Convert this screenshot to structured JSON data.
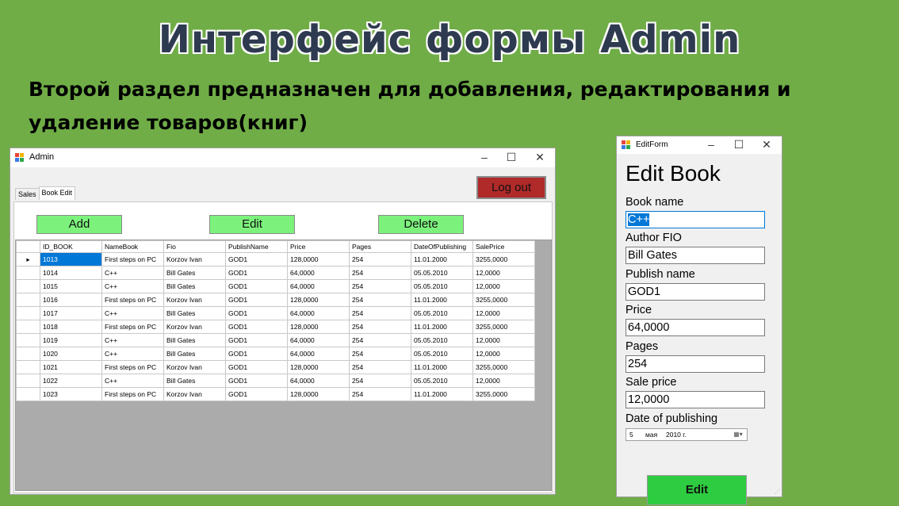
{
  "slide": {
    "title": "Интерфейс формы Admin",
    "subtitle": "Второй раздел предназначен для добавления, редактирования и удаление товаров(книг)"
  },
  "admin_window": {
    "title": "Admin",
    "controls": {
      "minimize": "–",
      "maximize": "☐",
      "close": "✕"
    },
    "tabs": [
      {
        "label": "Sales",
        "active": false
      },
      {
        "label": "Book Edit",
        "active": true
      }
    ],
    "logout_label": "Log out",
    "add_label": "Add",
    "edit_label": "Edit",
    "delete_label": "Delete",
    "colors": {
      "logout": "#b02a2a",
      "action_buttons": "#7cf27c",
      "selection": "#0078d7"
    },
    "grid": {
      "row_indicator": "▸",
      "columns": [
        "ID_BOOK",
        "NameBook",
        "Fio",
        "PublishName",
        "Price",
        "Pages",
        "DateOfPublishing",
        "SalePrice"
      ],
      "rows": [
        [
          "1013",
          "First steps on PC",
          "Korzov Ivan",
          "GOD1",
          "128,0000",
          "254",
          "11.01.2000",
          "3255,0000"
        ],
        [
          "1014",
          "C++",
          "Bill Gates",
          "GOD1",
          "64,0000",
          "254",
          "05.05.2010",
          "12,0000"
        ],
        [
          "1015",
          "C++",
          "Bill Gates",
          "GOD1",
          "64,0000",
          "254",
          "05.05.2010",
          "12,0000"
        ],
        [
          "1016",
          "First steps on PC",
          "Korzov Ivan",
          "GOD1",
          "128,0000",
          "254",
          "11.01.2000",
          "3255,0000"
        ],
        [
          "1017",
          "C++",
          "Bill Gates",
          "GOD1",
          "64,0000",
          "254",
          "05.05.2010",
          "12,0000"
        ],
        [
          "1018",
          "First steps on PC",
          "Korzov Ivan",
          "GOD1",
          "128,0000",
          "254",
          "11.01.2000",
          "3255,0000"
        ],
        [
          "1019",
          "C++",
          "Bill Gates",
          "GOD1",
          "64,0000",
          "254",
          "05.05.2010",
          "12,0000"
        ],
        [
          "1020",
          "C++",
          "Bill Gates",
          "GOD1",
          "64,0000",
          "254",
          "05.05.2010",
          "12,0000"
        ],
        [
          "1021",
          "First steps on PC",
          "Korzov Ivan",
          "GOD1",
          "128,0000",
          "254",
          "11.01.2000",
          "3255,0000"
        ],
        [
          "1022",
          "C++",
          "Bill Gates",
          "GOD1",
          "64,0000",
          "254",
          "05.05.2010",
          "12,0000"
        ],
        [
          "1023",
          "First steps on PC",
          "Korzov Ivan",
          "GOD1",
          "128,0000",
          "254",
          "11.01.2000",
          "3255,0000"
        ]
      ]
    }
  },
  "edit_window": {
    "title": "EditForm",
    "controls": {
      "minimize": "–",
      "maximize": "☐",
      "close": "✕"
    },
    "heading": "Edit Book",
    "fields": {
      "book_name": {
        "label": "Book name",
        "value": "C++"
      },
      "author": {
        "label": "Author FIO",
        "value": "Bill Gates"
      },
      "publish": {
        "label": "Publish name",
        "value": "GOD1"
      },
      "price": {
        "label": "Price",
        "value": "64,0000"
      },
      "pages": {
        "label": "Pages",
        "value": "254"
      },
      "sale_price": {
        "label": "Sale price",
        "value": "12,0000"
      }
    },
    "date": {
      "label": "Date of publishing",
      "day": "5",
      "month": "мая",
      "year": "2010 г."
    },
    "button_label": "Edit",
    "colors": {
      "edit_button": "#2ecc40"
    }
  }
}
